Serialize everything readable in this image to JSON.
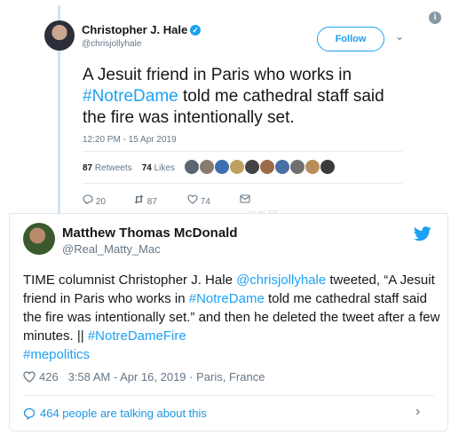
{
  "inner_tweet": {
    "author_name": "Christopher J. Hale",
    "author_handle": "@chrisjollyhale",
    "follow_label": "Follow",
    "text_before": "A Jesuit friend in Paris who works in ",
    "hashtag": "#NotreDame",
    "text_after": " told me cathedral staff said the fire was intentionally set.",
    "date": "12:20 PM - 15 Apr 2019",
    "retweets_count": "87",
    "retweets_label": "Retweets",
    "likes_count": "74",
    "likes_label": "Likes",
    "reply_count": "20",
    "retweet_action_count": "87",
    "like_action_count": "74",
    "watermark": "海外网"
  },
  "outer_tweet": {
    "author_name": "Matthew Thomas McDonald",
    "author_handle": "@Real_Matty_Mac",
    "text_1": "TIME columnist Christopher J. Hale ",
    "mention": "@chrisjollyhale",
    "text_2": " tweeted, “A Jesuit friend in Paris who works in ",
    "hashtag_1": "#NotreDame",
    "text_3": " told me cathedral staff said the fire was intentionally set.” and then he deleted the tweet after a few minutes. || ",
    "hashtag_2": "#NotreDameFire",
    "hashtag_3": "#mepolitics",
    "likes": "426",
    "timestamp": "3:58 AM - Apr 16, 2019",
    "separator": "·",
    "location": "Paris, France",
    "talking_label": "464 people are talking about this"
  },
  "colors": {
    "link": "#1da1f2",
    "muted": "#657786",
    "text": "#14171a",
    "border": "#e1e8ed"
  }
}
